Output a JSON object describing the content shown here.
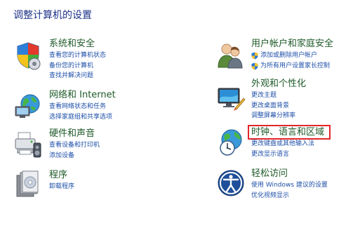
{
  "page": {
    "title": "调整计算机的设置"
  },
  "colors": {
    "title": "#1e3287",
    "category_title": "#1e5a28",
    "link": "#1e4fa8",
    "highlight": "#e3262a"
  },
  "categories": {
    "system_security": {
      "icon": "system-security-icon",
      "title": "系统和安全",
      "links": [
        "查看您的计算机状态",
        "备份您的计算机",
        "查找并解决问题"
      ]
    },
    "network_internet": {
      "icon": "network-internet-icon",
      "title": "网络和 Internet",
      "links": [
        "查看网络状态和任务",
        "选择家庭组和共享选项"
      ]
    },
    "hardware_sound": {
      "icon": "hardware-sound-icon",
      "title": "硬件和声音",
      "links": [
        "查看设备和打印机",
        "添加设备"
      ]
    },
    "programs": {
      "icon": "programs-icon",
      "title": "程序",
      "links": [
        "卸载程序"
      ]
    },
    "user_accounts": {
      "icon": "user-accounts-icon",
      "title": "用户帐户和家庭安全",
      "links": [
        "添加或删除用户帐户",
        "为所有用户设置家长控制"
      ],
      "link_icon": "uac-shield-icon"
    },
    "appearance": {
      "icon": "appearance-icon",
      "title": "外观和个性化",
      "links": [
        "更改主题",
        "更改桌面背景",
        "调整屏幕分辨率"
      ]
    },
    "clock_language_region": {
      "icon": "clock-language-region-icon",
      "title": "时钟、语言和区域",
      "links": [
        "更改键盘或其他输入法",
        "更改显示语言"
      ]
    },
    "ease_of_access": {
      "icon": "ease-of-access-icon",
      "title": "轻松访问",
      "links": [
        "使用 Windows 建议的设置",
        "优化视频显示"
      ]
    }
  }
}
